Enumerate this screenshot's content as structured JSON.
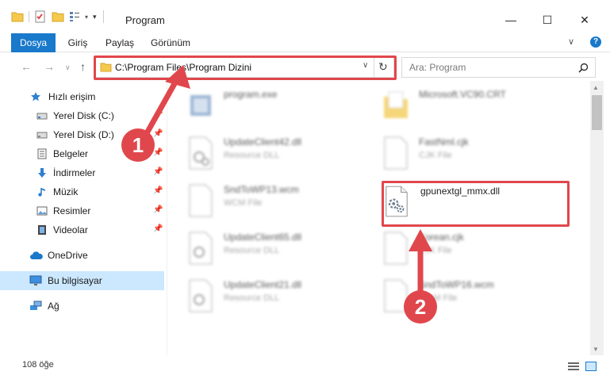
{
  "window": {
    "title": "Program",
    "minimize_glyph": "—",
    "maximize_glyph": "☐",
    "close_glyph": "✕"
  },
  "ribbon": {
    "tabs": [
      "Dosya",
      "Giriş",
      "Paylaş",
      "Görünüm"
    ],
    "help_glyph": "?",
    "collapse_glyph": "∨"
  },
  "address": {
    "path": "C:\\Program Files\\Program Dizini",
    "search_placeholder": "Ara: Program"
  },
  "nav_pane": {
    "items": [
      {
        "label": "Hızlı erişim",
        "icon": "star-icon"
      },
      {
        "label": "Yerel Disk (C:)",
        "icon": "drive-icon",
        "pinned": true
      },
      {
        "label": "Yerel Disk (D:)",
        "icon": "drive-icon",
        "pinned": true
      },
      {
        "label": "Belgeler",
        "icon": "documents-icon",
        "pinned": true
      },
      {
        "label": "İndirmeler",
        "icon": "download-icon",
        "pinned": true
      },
      {
        "label": "Müzik",
        "icon": "music-icon",
        "pinned": true
      },
      {
        "label": "Resimler",
        "icon": "pictures-icon",
        "pinned": true
      },
      {
        "label": "Videolar",
        "icon": "videos-icon",
        "pinned": true
      },
      {
        "label": "OneDrive",
        "icon": "cloud-icon"
      },
      {
        "label": "Bu bilgisayar",
        "icon": "computer-icon",
        "selected": true
      },
      {
        "label": "Ağ",
        "icon": "network-icon"
      }
    ]
  },
  "files": [
    {
      "name": "program.exe",
      "type": "",
      "blurred": true,
      "icon": "exe-icon"
    },
    {
      "name": "Microsoft.VC90.CRT",
      "type": "",
      "blurred": true,
      "icon": "folder-icon"
    },
    {
      "name": "UpdateClient42.dll",
      "type": "Resource DLL",
      "blurred": true,
      "icon": "dll-icon"
    },
    {
      "name": "FastNml.cjk",
      "type": "CJK File",
      "blurred": true,
      "icon": "file-icon"
    },
    {
      "name": "SndToWP13.wcm",
      "type": "WCM File",
      "blurred": true,
      "icon": "file-icon"
    },
    {
      "name": "gpunextgl_mmx.dll",
      "type": "",
      "blurred": false,
      "icon": "dll-icon"
    },
    {
      "name": "UpdateClient65.dll",
      "type": "Resource DLL",
      "blurred": true,
      "icon": "dll-icon"
    },
    {
      "name": "Korean.cjk",
      "type": "CJK File",
      "blurred": true,
      "icon": "file-icon"
    },
    {
      "name": "UpdateClient21.dll",
      "type": "Resource DLL",
      "blurred": true,
      "icon": "dll-icon"
    },
    {
      "name": "SndToWP16.wcm",
      "type": "WCM File",
      "blurred": true,
      "icon": "file-icon"
    }
  ],
  "status": {
    "item_count": "108 öğe"
  },
  "annotations": {
    "step1": "1",
    "step2": "2"
  },
  "colors": {
    "accent": "#1979ca",
    "annotation_red": "#e0474c",
    "selection": "#cce8ff"
  }
}
